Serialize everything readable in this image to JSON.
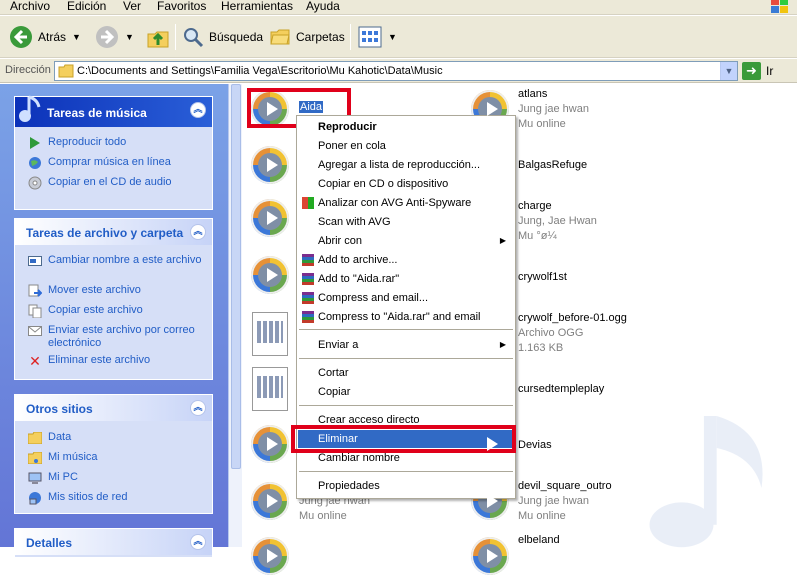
{
  "menu": [
    "Archivo",
    "Edición",
    "Ver",
    "Favoritos",
    "Herramientas",
    "Ayuda"
  ],
  "toolbar": {
    "back": "Atrás",
    "search": "Búsqueda",
    "folders": "Carpetas"
  },
  "address": {
    "label": "Dirección",
    "path": "C:\\Documents and Settings\\Familia Vega\\Escritorio\\Mu Kahotic\\Data\\Music",
    "go": "Ir"
  },
  "panels": {
    "music": {
      "title": "Tareas de música",
      "items": [
        "Reproducir todo",
        "Comprar música en línea",
        "Copiar en el CD de audio"
      ]
    },
    "file": {
      "title": "Tareas de archivo y carpeta",
      "items": [
        "Cambiar nombre a este archivo",
        "Mover este archivo",
        "Copiar este archivo",
        "Enviar este archivo por correo electrónico",
        "Eliminar este archivo"
      ]
    },
    "other": {
      "title": "Otros sitios",
      "items": [
        "Data",
        "Mi música",
        "Mi PC",
        "Mis sitios de red"
      ]
    },
    "details": {
      "title": "Detalles"
    }
  },
  "files": {
    "left": [
      {
        "name": "Aida"
      },
      {
        "name": ""
      },
      {
        "name": ""
      },
      {
        "name": ""
      },
      {
        "name": ""
      },
      {
        "name": ""
      },
      {
        "name": ""
      },
      {
        "name": "",
        "sub1": "Jung jae hwan",
        "sub2": "Mu online"
      }
    ],
    "right": [
      {
        "name": "atlans",
        "sub1": "Jung jae hwan",
        "sub2": "Mu online"
      },
      {
        "name": "BalgasRefuge"
      },
      {
        "name": "charge",
        "sub1": "Jung, Jae Hwan",
        "sub2": "Mu °ø¼"
      },
      {
        "name": "crywolf1st"
      },
      {
        "name": "crywolf_before-01.ogg",
        "sub1": "Archivo OGG",
        "sub2": "1.163 KB"
      },
      {
        "name": "cursedtempleplay"
      },
      {
        "name": "Devias"
      },
      {
        "name": "devil_square_outro",
        "sub1": "Jung jae hwan",
        "sub2": "Mu online"
      },
      {
        "name": "elbeland"
      }
    ]
  },
  "context_menu": {
    "items": [
      {
        "label": "Reproducir",
        "bold": true
      },
      {
        "label": "Poner en cola"
      },
      {
        "label": "Agregar a lista de reproducción..."
      },
      {
        "label": "Copiar en CD o dispositivo"
      },
      {
        "label": "Analizar con AVG Anti-Spyware"
      },
      {
        "label": "Scan with AVG"
      },
      {
        "label": "Abrir con"
      },
      {
        "label": "Add to archive..."
      },
      {
        "label": "Add to \"Aida.rar\""
      },
      {
        "label": "Compress and email..."
      },
      {
        "label": "Compress to \"Aida.rar\" and email"
      },
      {
        "label": "Enviar a"
      },
      {
        "label": "Cortar"
      },
      {
        "label": "Copiar"
      },
      {
        "label": "Crear acceso directo"
      },
      {
        "label": "Eliminar"
      },
      {
        "label": "Cambiar nombre"
      },
      {
        "label": "Propiedades"
      }
    ]
  },
  "colors": {
    "highlight": "#316ac5",
    "annotation_red": "#e0001a",
    "task_pane_bg": "#6375d6"
  }
}
